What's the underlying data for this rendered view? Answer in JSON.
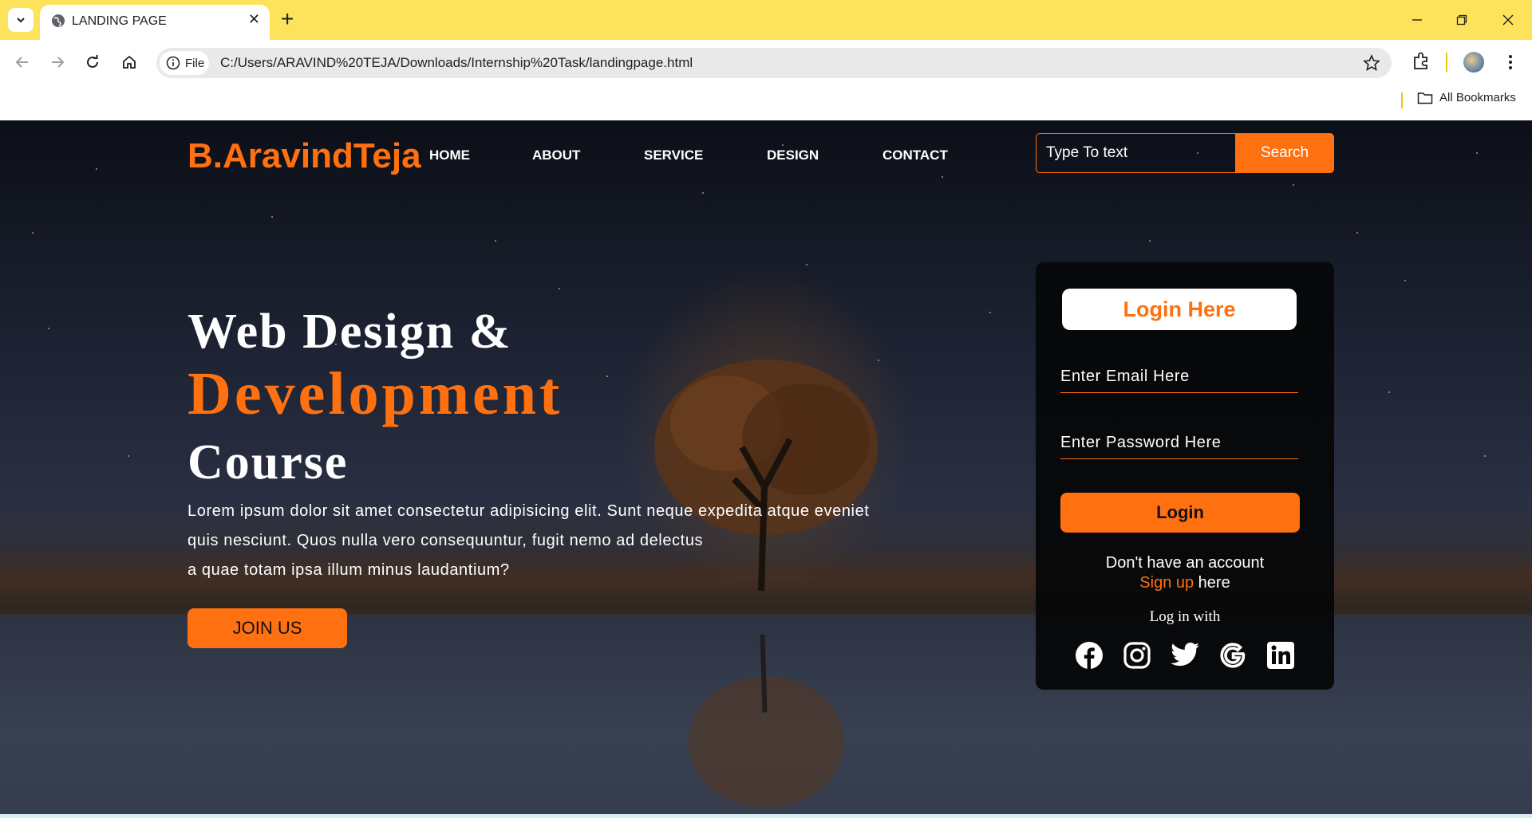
{
  "browser": {
    "tab_title": "LANDING PAGE",
    "url_chip": "File",
    "url": "C:/Users/ARAVIND%20TEJA/Downloads/Internship%20Task/landingpage.html",
    "bookmarks_label": "All Bookmarks"
  },
  "site": {
    "logo": "B.AravindTeja",
    "nav": [
      "HOME",
      "ABOUT",
      "SERVICE",
      "DESIGN",
      "CONTACT"
    ],
    "search": {
      "placeholder": "Type To text",
      "button": "Search"
    }
  },
  "hero": {
    "line1": "Web Design &",
    "line2": "Development",
    "line3": "Course",
    "para_line1": "Lorem ipsum dolor sit amet consectetur adipisicing elit. Sunt neque expedita atque eveniet",
    "para_line2": "quis nesciunt. Quos nulla vero consequuntur, fugit nemo ad delectus",
    "para_line3": "a quae totam ipsa illum minus laudantium?",
    "cta": "JOIN US"
  },
  "login": {
    "title": "Login Here",
    "email_placeholder": "Enter Email Here",
    "password_placeholder": "Enter Password Here",
    "button": "Login",
    "no_account": "Don't have an account",
    "signup_link": "Sign up",
    "signup_suffix": " here",
    "log_in_with": "Log in with",
    "social_icons": [
      "facebook-icon",
      "instagram-icon",
      "twitter-icon",
      "google-icon",
      "linkedin-icon"
    ]
  },
  "colors": {
    "accent": "#ff7010",
    "tab_bar": "#fde35c",
    "card": "#050608"
  }
}
